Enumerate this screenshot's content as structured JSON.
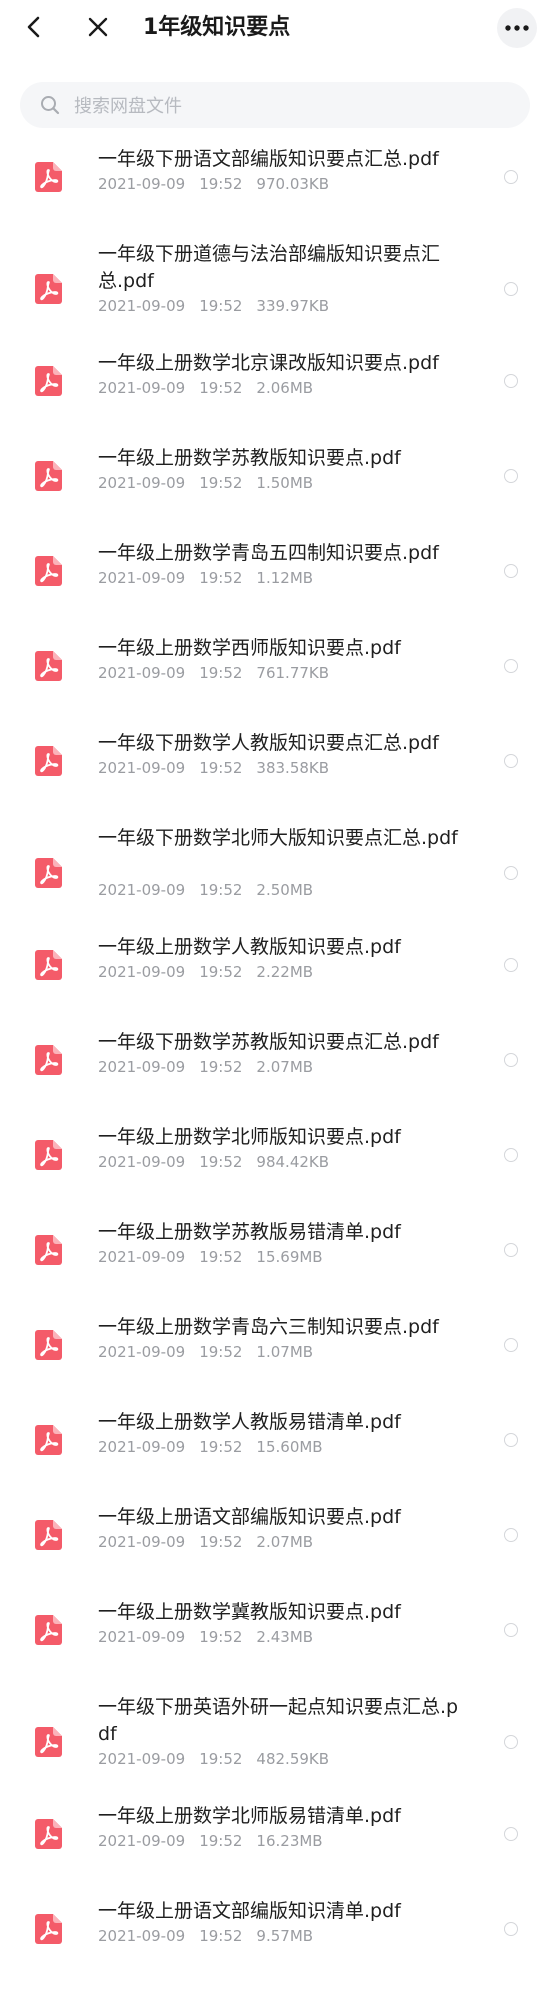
{
  "header": {
    "title": "1年级知识要点"
  },
  "search": {
    "placeholder": "搜索网盘文件"
  },
  "files": [
    {
      "name": "一年级下册语文部编版知识要点汇总.pdf",
      "date": "2021-09-09",
      "time": "19:52",
      "size": "970.03KB"
    },
    {
      "name": "一年级下册道德与法治部编版知识要点汇总.pdf",
      "date": "2021-09-09",
      "time": "19:52",
      "size": "339.97KB"
    },
    {
      "name": "一年级上册数学北京课改版知识要点.pdf",
      "date": "2021-09-09",
      "time": "19:52",
      "size": "2.06MB"
    },
    {
      "name": "一年级上册数学苏教版知识要点.pdf",
      "date": "2021-09-09",
      "time": "19:52",
      "size": "1.50MB"
    },
    {
      "name": "一年级上册数学青岛五四制知识要点.pdf",
      "date": "2021-09-09",
      "time": "19:52",
      "size": "1.12MB"
    },
    {
      "name": "一年级上册数学西师版知识要点.pdf",
      "date": "2021-09-09",
      "time": "19:52",
      "size": "761.77KB"
    },
    {
      "name": "一年级下册数学人教版知识要点汇总.pdf",
      "date": "2021-09-09",
      "time": "19:52",
      "size": "383.58KB"
    },
    {
      "name": "一年级下册数学北师大版知识要点汇总.pdf",
      "date": "2021-09-09",
      "time": "19:52",
      "size": "2.50MB"
    },
    {
      "name": "一年级上册数学人教版知识要点.pdf",
      "date": "2021-09-09",
      "time": "19:52",
      "size": "2.22MB"
    },
    {
      "name": "一年级下册数学苏教版知识要点汇总.pdf",
      "date": "2021-09-09",
      "time": "19:52",
      "size": "2.07MB"
    },
    {
      "name": "一年级上册数学北师版知识要点.pdf",
      "date": "2021-09-09",
      "time": "19:52",
      "size": "984.42KB"
    },
    {
      "name": "一年级上册数学苏教版易错清单.pdf",
      "date": "2021-09-09",
      "time": "19:52",
      "size": "15.69MB"
    },
    {
      "name": "一年级上册数学青岛六三制知识要点.pdf",
      "date": "2021-09-09",
      "time": "19:52",
      "size": "1.07MB"
    },
    {
      "name": "一年级上册数学人教版易错清单.pdf",
      "date": "2021-09-09",
      "time": "19:52",
      "size": "15.60MB"
    },
    {
      "name": "一年级上册语文部编版知识要点.pdf",
      "date": "2021-09-09",
      "time": "19:52",
      "size": "2.07MB"
    },
    {
      "name": "一年级上册数学冀教版知识要点.pdf",
      "date": "2021-09-09",
      "time": "19:52",
      "size": "2.43MB"
    },
    {
      "name": "一年级下册英语外研一起点知识要点汇总.pdf",
      "date": "2021-09-09",
      "time": "19:52",
      "size": "482.59KB"
    },
    {
      "name": "一年级上册数学北师版易错清单.pdf",
      "date": "2021-09-09",
      "time": "19:52",
      "size": "16.23MB"
    },
    {
      "name": "一年级上册语文部编版知识清单.pdf",
      "date": "2021-09-09",
      "time": "19:52",
      "size": "9.57MB"
    }
  ],
  "colors": {
    "pdf_icon": "#f45b69",
    "meta_text": "#9a9ca1"
  },
  "icons": {
    "back": "chevron-left-icon",
    "close": "close-icon",
    "more": "more-icon",
    "search": "search-icon",
    "file": "pdf-icon"
  }
}
